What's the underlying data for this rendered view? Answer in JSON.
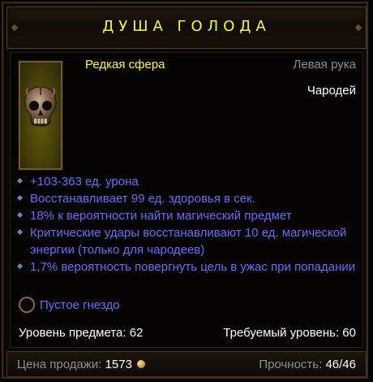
{
  "header": {
    "title": "ДУША ГОЛОДА"
  },
  "item": {
    "name": "Редкая сфера",
    "slot": "Левая рука",
    "class": "Чародей",
    "portrait_icon": "skull-orb-icon"
  },
  "affixes": [
    "+103-363 ед. урона",
    "Восстанавливает 99 ед. здоровья в сек.",
    "18% к вероятности найти магический предмет",
    "Критические удары восстанавливают 10 ед. магической энергии (только для чародеев)",
    "1,7% вероятность повергнуть цель в ужас при попадании"
  ],
  "socket": {
    "label": "Пустое гнездо"
  },
  "levels": {
    "item_level_label": "Уровень предмета: 62",
    "required_level_label": "Требуемый уровень: 60"
  },
  "footer": {
    "sell_label": "Цена продажи:",
    "sell_value": "1573",
    "durability_label": "Прочность:",
    "durability_value": "46/46"
  },
  "colors": {
    "title": "#ffff00",
    "rare_name": "#ffff00",
    "affix": "#6969ff",
    "slot": "#8e8e8e",
    "text": "#ffffff"
  }
}
